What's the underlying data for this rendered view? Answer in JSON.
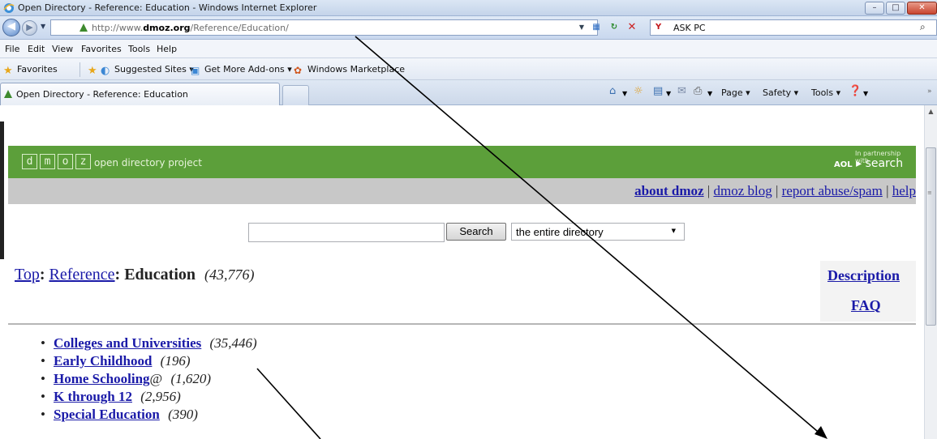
{
  "window": {
    "title": "Open Directory - Reference: Education - Windows Internet Explorer"
  },
  "address_bar": {
    "url_prefix": "http://www.",
    "url_domain": "dmoz.org",
    "url_path": "/Reference/Education/"
  },
  "search_bar": {
    "engine_label": "ASK PC",
    "logo": "Y"
  },
  "menu": [
    "File",
    "Edit",
    "View",
    "Favorites",
    "Tools",
    "Help"
  ],
  "favorites_bar": {
    "favorites": "Favorites",
    "items": [
      "Suggested Sites ▾",
      "Get More Add-ons ▾",
      "Windows Marketplace"
    ]
  },
  "tab": {
    "label": "Open Directory - Reference: Education"
  },
  "command_bar": {
    "page": "Page ▾",
    "safety": "Safety ▾",
    "tools": "Tools ▾"
  },
  "dmoz": {
    "logo_letters": [
      "d",
      "m",
      "o",
      "z"
    ],
    "tagline": "open directory project",
    "partner_small": "In partnership with",
    "partner_aol": "AOL",
    "partner_search": "search",
    "links": {
      "about": "about dmoz",
      "blog": "dmoz blog",
      "report": "report abuse/spam",
      "help": "help",
      "separator": "|"
    },
    "search": {
      "button": "Search",
      "scope": "the entire directory",
      "input_value": ""
    },
    "breadcrumb": {
      "top": "Top",
      "reference": "Reference",
      "current": "Education",
      "count": "(43,776)",
      "sep": ":"
    },
    "side": {
      "description": "Description",
      "faq": "FAQ"
    },
    "categories": [
      {
        "label": "Colleges and Universities",
        "suffix": "",
        "count": "(35,446)"
      },
      {
        "label": "Early Childhood",
        "suffix": "",
        "count": "(196)"
      },
      {
        "label": "Home Schooling",
        "suffix": "@",
        "count": "(1,620)"
      },
      {
        "label": "K through 12",
        "suffix": "",
        "count": "(2,956)"
      },
      {
        "label": "Special Education",
        "suffix": "",
        "count": "(390)"
      }
    ]
  }
}
